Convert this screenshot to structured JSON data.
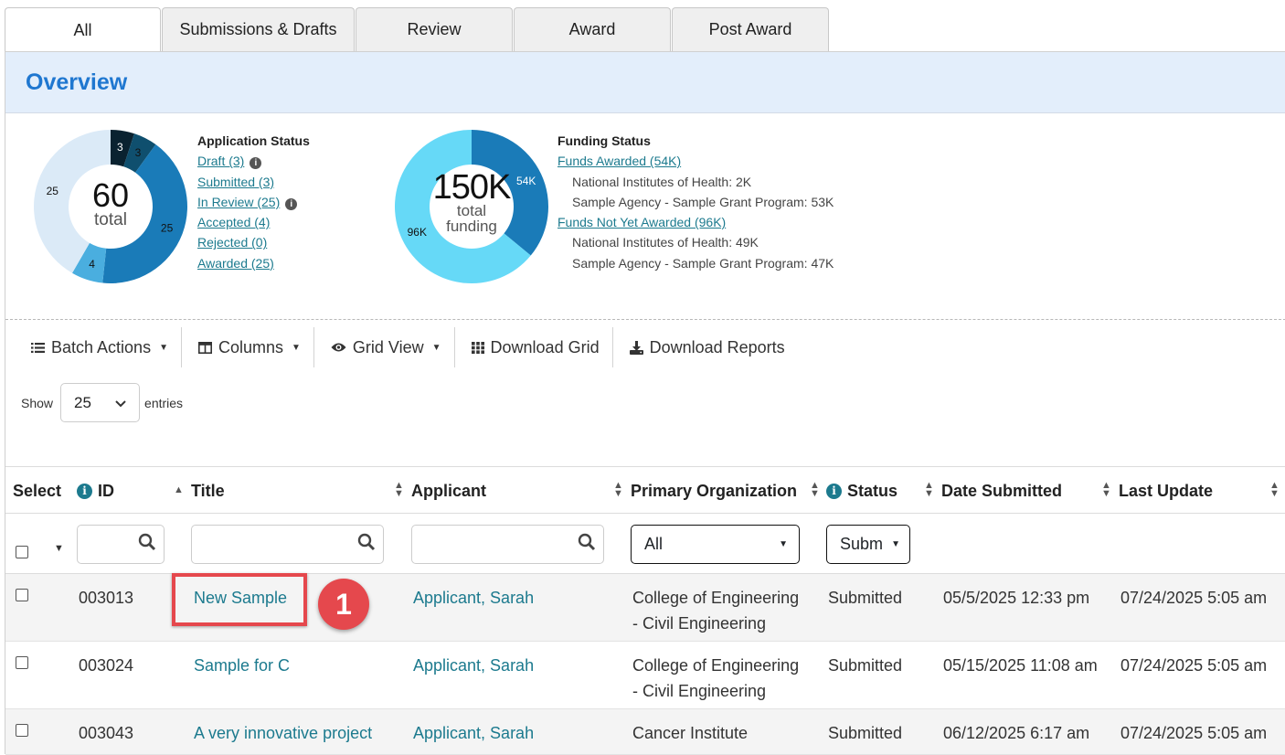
{
  "tabs": [
    {
      "label": "All",
      "active": true
    },
    {
      "label": "Submissions & Drafts"
    },
    {
      "label": "Review"
    },
    {
      "label": "Award"
    },
    {
      "label": "Post Award"
    }
  ],
  "overview": {
    "title": "Overview"
  },
  "application_status": {
    "title": "Application Status",
    "total": "60",
    "total_label": "total",
    "items": [
      {
        "label": "Draft (3)",
        "info": true
      },
      {
        "label": "Submitted (3)"
      },
      {
        "label": "In Review (25)",
        "info": true
      },
      {
        "label": "Accepted (4)"
      },
      {
        "label": "Rejected (0)"
      },
      {
        "label": "Awarded (25)"
      }
    ],
    "segments": [
      {
        "name": "Draft",
        "value": 3,
        "label": "3",
        "color": "#0a2230"
      },
      {
        "name": "Submitted",
        "value": 3,
        "label": "3",
        "color": "#0f4f6e"
      },
      {
        "name": "Awarded",
        "value": 25,
        "label": "25",
        "color": "#1a7bb8"
      },
      {
        "name": "Accepted",
        "value": 4,
        "label": "4",
        "color": "#4aaedf"
      },
      {
        "name": "In Review",
        "value": 25,
        "label": "25",
        "color": "#dbeaf7"
      }
    ]
  },
  "funding_status": {
    "title": "Funding Status",
    "total": "150K",
    "total_label_1": "total",
    "total_label_2": "funding",
    "awarded_label": "Funds Awarded (54K)",
    "awarded_items": [
      "National Institutes of Health: 2K",
      "Sample Agency - Sample Grant Program: 53K"
    ],
    "not_awarded_label": "Funds Not Yet Awarded (96K)",
    "not_awarded_items": [
      "National Institutes of Health: 49K",
      "Sample Agency - Sample Grant Program: 47K"
    ],
    "segments": [
      {
        "name": "Funds Awarded",
        "value": 54,
        "label": "54K",
        "color": "#1a7bb8"
      },
      {
        "name": "Funds Not Yet Awarded",
        "value": 96,
        "label": "96K",
        "color": "#66d9f7"
      }
    ]
  },
  "toolbar": {
    "batch_actions": "Batch Actions",
    "columns": "Columns",
    "grid_view": "Grid View",
    "download_grid": "Download Grid",
    "download_reports": "Download Reports"
  },
  "entries": {
    "show": "Show",
    "value": "25",
    "suffix": "entries"
  },
  "table": {
    "headers": {
      "select": "Select",
      "id": "ID",
      "title": "Title",
      "applicant": "Applicant",
      "primary_org": "Primary Organization",
      "status": "Status",
      "date_submitted": "Date Submitted",
      "last_update": "Last Update"
    },
    "filters": {
      "org": "All",
      "status": "Subm"
    },
    "rows": [
      {
        "id": "003013",
        "title": "New Sample",
        "applicant": "Applicant, Sarah",
        "org_1": "College of Engineering",
        "org_2": "- Civil Engineering",
        "status": "Submitted",
        "date_submitted": "05/5/2025 12:33 pm",
        "last_update": "07/24/2025 5:05 am"
      },
      {
        "id": "003024",
        "title": "Sample for C",
        "applicant": "Applicant, Sarah",
        "org_1": "College of Engineering",
        "org_2": "- Civil Engineering",
        "status": "Submitted",
        "date_submitted": "05/15/2025 11:08 am",
        "last_update": "07/24/2025 5:05 am"
      },
      {
        "id": "003043",
        "title": "A very innovative project",
        "applicant": "Applicant, Sarah",
        "org_1": "Cancer Institute",
        "org_2": "",
        "status": "Submitted",
        "date_submitted": "06/12/2025 6:17 am",
        "last_update": "07/24/2025 5:05 am"
      }
    ]
  },
  "annotation": {
    "badge": "1"
  }
}
